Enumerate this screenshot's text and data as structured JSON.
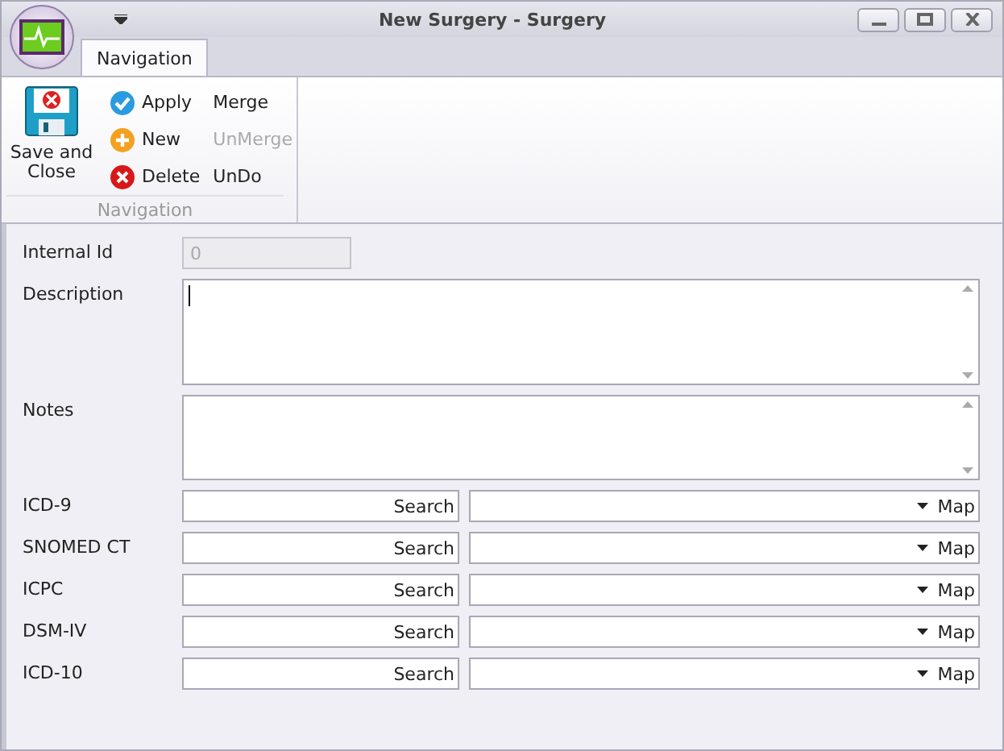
{
  "window": {
    "title": "New Surgery - Surgery"
  },
  "tabs": [
    {
      "label": "Navigation",
      "selected": true
    }
  ],
  "ribbon": {
    "group_label": "Navigation",
    "buttons": [
      {
        "kind": "large",
        "label": "Save and Close"
      },
      {
        "kind": "small",
        "label": "Apply",
        "disabled": false
      },
      {
        "kind": "small",
        "label": "New",
        "disabled": false
      },
      {
        "kind": "small",
        "label": "Delete",
        "disabled": false
      },
      {
        "kind": "small",
        "label": "Merge",
        "disabled": false
      },
      {
        "kind": "small",
        "label": "UnMerge",
        "disabled": true
      },
      {
        "kind": "small",
        "label": "UnDo",
        "disabled": false
      }
    ]
  },
  "form": {
    "internal_id": {
      "label": "Internal Id",
      "value": "0",
      "disabled": true
    },
    "description": {
      "label": "Description",
      "focused": true
    },
    "notes": {
      "label": "Notes",
      "focused": false
    },
    "codings": [
      {
        "label": "ICD-9",
        "search_button": "Search",
        "map_button": "Map"
      },
      {
        "label": "SNOMED CT",
        "search_button": "Search",
        "map_button": "Map"
      },
      {
        "label": "ICPC",
        "search_button": "Search",
        "map_button": "Map"
      },
      {
        "label": "DSM-IV",
        "search_button": "Search",
        "map_button": "Map"
      },
      {
        "label": "ICD-10",
        "search_button": "Search",
        "map_button": "Map"
      }
    ]
  }
}
